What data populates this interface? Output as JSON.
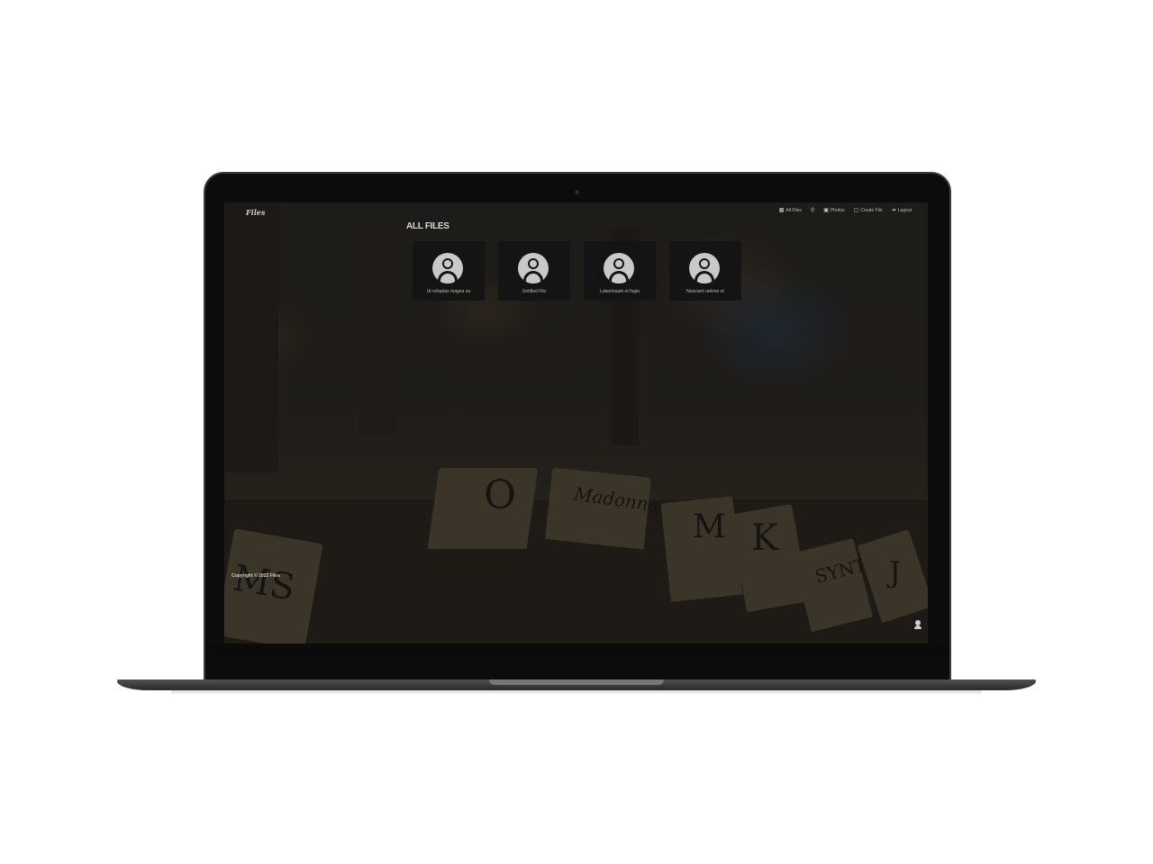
{
  "app": {
    "brand": "Files"
  },
  "nav": {
    "items": [
      {
        "icon": "folder-icon",
        "label": "All Files"
      },
      {
        "icon": "search-icon",
        "label": ""
      },
      {
        "icon": "image-icon",
        "label": "Photos"
      },
      {
        "icon": "file-plus-icon",
        "label": "Create File"
      },
      {
        "icon": "logout-icon",
        "label": "Logout"
      }
    ]
  },
  "main": {
    "title": "ALL FILES",
    "files": [
      {
        "name": "Ut voluptas magna eu"
      },
      {
        "name": "Untitled File"
      },
      {
        "name": "Laboriosam et fugia"
      },
      {
        "name": "Nesciunt ratione et"
      }
    ]
  },
  "footer": {
    "copyright": "Copyright © 2022 Files"
  },
  "colors": {
    "overlay": "#1a1816",
    "card_bg": "#141414",
    "text": "#cfcfcf"
  }
}
